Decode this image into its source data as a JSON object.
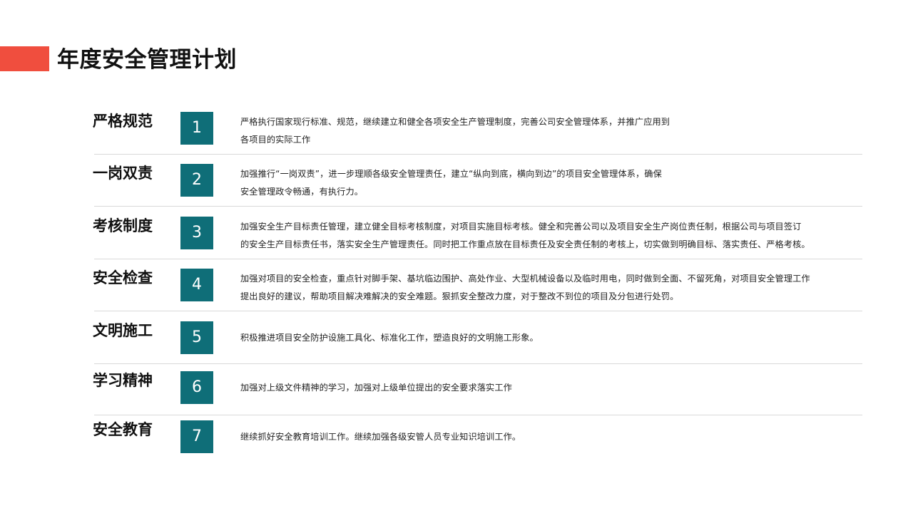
{
  "page": {
    "title": "年度安全管理计划",
    "accent_color": "#f04e3e",
    "number_box_color": "#0f6e78"
  },
  "items": [
    {
      "heading": "严格规范",
      "number": "1",
      "lines": [
        "严格执行国家现行标准、规范，继续建立和健全各项安全生产管理制度，完善公司安全管理体系，并推广应用到",
        "各项目的实际工作"
      ]
    },
    {
      "heading": "一岗双责",
      "number": "2",
      "lines": [
        "加强推行“一岗双责”，进一步理顺各级安全管理责任，建立“纵向到底，横向到边”的项目安全管理体系，确保",
        "安全管理政令畅通，有执行力。"
      ]
    },
    {
      "heading": "考核制度",
      "number": "3",
      "lines": [
        "加强安全生产目标责任管理，建立健全目标考核制度，对项目实施目标考核。健全和完善公司以及项目安全生产岗位责任制，根据公司与项目签订",
        "的安全生产目标责任书，落实安全生产管理责任。同时把工作重点放在目标责任及安全责任制的考核上，切实做到明确目标、落实责任、严格考核。"
      ]
    },
    {
      "heading": "安全检查",
      "number": "4",
      "lines": [
        "加强对项目的安全检查，重点针对脚手架、基坑临边围护、高处作业、大型机械设备以及临时用电，同时做到全面、不留死角，对项目安全管理工作",
        "提出良好的建议，帮助项目解决难解决的安全难题。狠抓安全整改力度，对于整改不到位的项目及分包进行处罚。"
      ]
    },
    {
      "heading": "文明施工",
      "number": "5",
      "lines": [
        "积极推进项目安全防护设施工具化、标准化工作，塑造良好的文明施工形象。"
      ]
    },
    {
      "heading": "学习精神",
      "number": "6",
      "lines": [
        "加强对上级文件精神的学习，加强对上级单位提出的安全要求落实工作"
      ]
    },
    {
      "heading": "安全教育",
      "number": "7",
      "lines": [
        "继续抓好安全教育培训工作。继续加强各级安管人员专业知识培训工作。"
      ]
    }
  ]
}
